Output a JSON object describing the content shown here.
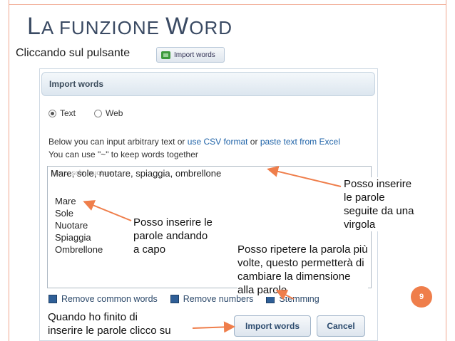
{
  "slide": {
    "title_initial_L": "L",
    "title_rest_a": "A FUNZIONE ",
    "title_initial_W": "W",
    "title_rest_b": "ORD",
    "intro": "Cliccando sul pulsante",
    "page_number": "9"
  },
  "mini_button": {
    "label": "Import words",
    "icon": "import-icon"
  },
  "dialog": {
    "header": "Import words",
    "radio_text": "Text",
    "radio_web": "Web",
    "desc1_a": "Below you can input arbitrary text or ",
    "desc1_link1": "use CSV format",
    "desc1_b": " or ",
    "desc1_link2": "paste text from Excel",
    "desc2": "You can use \"~\" to keep words together",
    "input_line": "Mare, sole, nuotare, spiaggia, ombrellone",
    "ghost_text": "Mare, sole, nuotare",
    "list_words": [
      "Mare",
      "Sole",
      "Nuotare",
      "Spiaggia",
      "Ombrellone"
    ],
    "check_common": "Remove common words",
    "check_numbers": "Remove numbers",
    "check_stemming": "Stemming",
    "btn_import": "Import words",
    "btn_cancel": "Cancel"
  },
  "annotations": {
    "comma_1": "Posso inserire",
    "comma_2": "le parole",
    "comma_3": "seguite da una",
    "comma_4": "virgola",
    "newline_1": "Posso inserire le",
    "newline_2": "parole andando",
    "newline_3": "a capo",
    "repeat_1": "Posso ripetere la parola più",
    "repeat_2": "volte, questo permetterà di",
    "repeat_3": "cambiare la dimensione",
    "repeat_4": "alla parole",
    "finish_1": "Quando ho finito di",
    "finish_2": "inserire le parole clicco su"
  },
  "colors": {
    "accent": "#ef7e4b",
    "title": "#3a4a63",
    "link": "#1f63a8"
  }
}
